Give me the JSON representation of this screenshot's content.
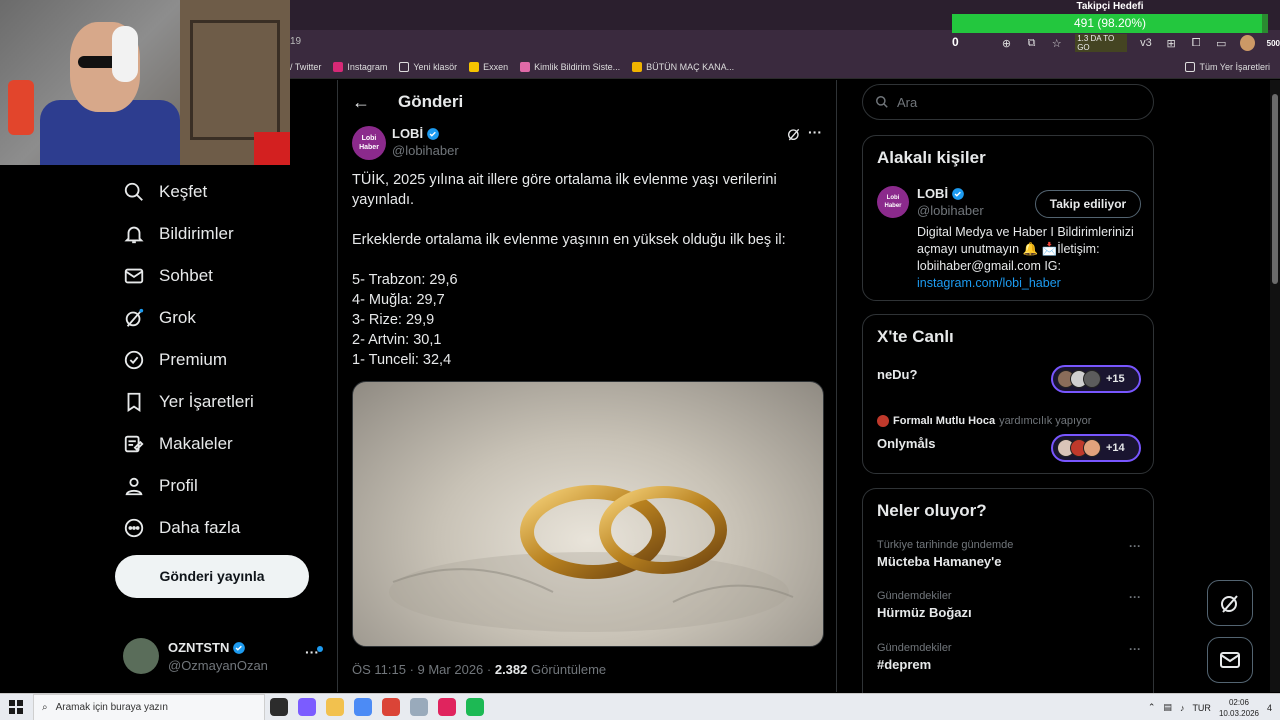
{
  "browser": {
    "tab_number_fragment": "19",
    "goal": {
      "title": "Takipçi Hedefi",
      "value_text": "491 (98.20%)",
      "progress": 0.982,
      "counter": "0"
    },
    "toolbar_extra": "1.3 DA TO GO",
    "toolbar_v3": "v3",
    "toolbar_count": "500",
    "bookmarks": [
      {
        "label": "/ Twitter",
        "icon": "x-logo-icon",
        "color": "#000000"
      },
      {
        "label": "Instagram",
        "icon": "instagram-icon",
        "color": "#d62976"
      },
      {
        "label": "Yeni klasör",
        "icon": "folder-icon",
        "color": "#dddddd"
      },
      {
        "label": "Exxen",
        "icon": "exxen-icon",
        "color": "#f5c400"
      },
      {
        "label": "Kimlik Bildirim Siste...",
        "icon": "feather-icon",
        "color": "#e06aa8"
      },
      {
        "label": "BÜTÜN MAÇ KANA...",
        "icon": "jp-icon",
        "color": "#f0b400"
      }
    ],
    "bookmarks_right": "Tüm Yer İşaretleri"
  },
  "nav": {
    "items": [
      {
        "label": "Keşfet",
        "icon": "search-icon"
      },
      {
        "label": "Bildirimler",
        "icon": "bell-icon"
      },
      {
        "label": "Sohbet",
        "icon": "mail-icon"
      },
      {
        "label": "Grok",
        "icon": "grok-icon"
      },
      {
        "label": "Premium",
        "icon": "verified-badge-icon"
      },
      {
        "label": "Yer İşaretleri",
        "icon": "bookmark-icon"
      },
      {
        "label": "Makaleler",
        "icon": "article-icon"
      },
      {
        "label": "Profil",
        "icon": "person-icon"
      },
      {
        "label": "Daha fazla",
        "icon": "more-circle-icon"
      }
    ],
    "post_button": "Gönderi yayınla",
    "account": {
      "name": "OZNTSTN",
      "handle": "@OzmayanOzan",
      "more": "···"
    }
  },
  "post": {
    "header_title": "Gönderi",
    "author": {
      "name": "LOBİ",
      "handle": "@lobihaber",
      "logo_line1": "Lobi",
      "logo_line2": "Haber"
    },
    "text_intro": "TÜİK, 2025 yılına ait illere göre ortalama ilk evlenme yaşı verilerini yayınladı.",
    "text_sub": "Erkeklerde ortalama ilk evlenme yaşının en yüksek olduğu ilk beş il:",
    "list": [
      "5- Trabzon: 29,6",
      "4- Muğla: 29,7",
      "3- Rize: 29,9",
      "2- Artvin: 30,1",
      "1- Tunceli: 32,4"
    ],
    "meta_time": "ÖS 11:15 · 9 Mar 2026 · ",
    "meta_views": "2.382",
    "meta_views_label": " Görüntüleme"
  },
  "sidebar": {
    "search_placeholder": "Ara",
    "related": {
      "title": "Alakalı kişiler",
      "name": "LOBİ",
      "handle": "@lobihaber",
      "follow_label": "Takip ediliyor",
      "bio": "Digital Medya ve Haber I Bildirimlerinizi açmayı unutmayın 🔔 📩İletişim: lobiihaber@gmail.com IG: ",
      "bio_link": "instagram.com/lobi_haber"
    },
    "live": {
      "title": "X'te Canlı",
      "spaces": [
        {
          "name": "neDu?",
          "count": "+15"
        },
        {
          "name": "Onlymåls",
          "count": "+14"
        }
      ],
      "host_name": "Formalı Mutlu Hoca",
      "host_suffix": "yardımcılık yapıyor"
    },
    "trends": {
      "title": "Neler oluyor?",
      "items": [
        {
          "context": "Türkiye tarihinde gündemde",
          "topic": "Mücteba Hamaney'e"
        },
        {
          "context": "Gündemdekiler",
          "topic": "Hürmüz Boğazı"
        },
        {
          "context": "Gündemdekiler",
          "topic": "#deprem"
        }
      ]
    }
  },
  "taskbar": {
    "search_placeholder": "Aramak için buraya yazın",
    "lang": "TUR",
    "time": "02:06",
    "date": "10.03.2026",
    "notifications": "4"
  },
  "colors": {
    "accent": "#1d9bf0",
    "goal_bar": "#23c73e",
    "live_border": "#7856ff"
  }
}
